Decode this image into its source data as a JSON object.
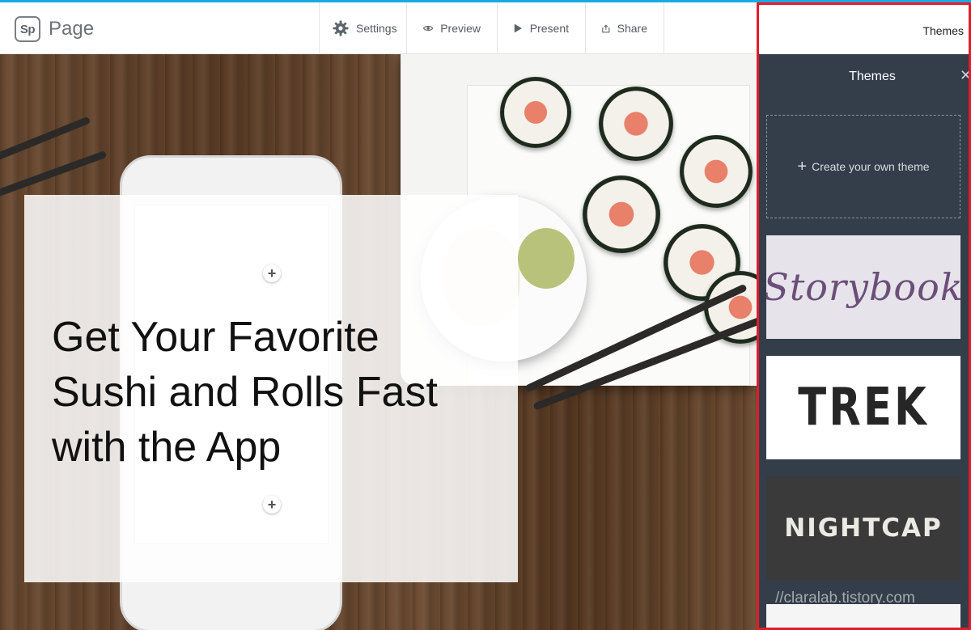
{
  "app": {
    "logo_mark": "Sp",
    "name": "Page"
  },
  "toolbar": {
    "settings_label": "Settings",
    "preview_label": "Preview",
    "present_label": "Present",
    "share_label": "Share"
  },
  "hero": {
    "title_line1": "Get Your Favorite",
    "title_line2": "Sushi and Rolls Fast",
    "title_line3": "with the App"
  },
  "themes_panel": {
    "header_link": "Themes",
    "title": "Themes",
    "create_label": "Create your own theme",
    "themes": [
      {
        "name": "Storybook"
      },
      {
        "name": "TREK"
      },
      {
        "name": "NIGHTCAP"
      }
    ],
    "watermark": "//claralab.tistory.com"
  },
  "colors": {
    "accent_top_border": "#1ba9e1",
    "panel_bg": "#333e4a",
    "highlight_red": "#e21c2a"
  }
}
